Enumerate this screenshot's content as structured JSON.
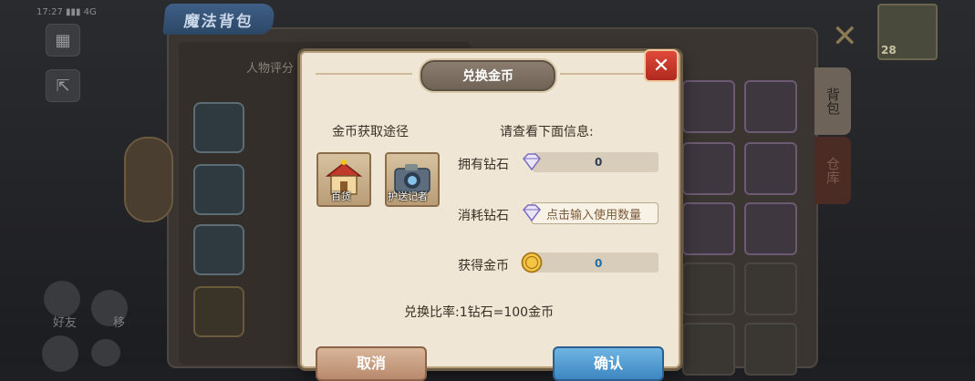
{
  "status_bar": {
    "text": "17:27 ▮▮▮ 4G"
  },
  "background": {
    "bag_title": "魔法背包",
    "rating_label": "人物评分",
    "tabs": {
      "bag": "背包",
      "storage": "仓库"
    },
    "level": "28",
    "bottom_labels": {
      "friends": "好友",
      "second": "移"
    }
  },
  "dialog": {
    "title": "兑换金币",
    "left_section_title": "金币获取途径",
    "sources": [
      {
        "label": "百货",
        "icon": "shop-icon"
      },
      {
        "label": "护送记者",
        "icon": "camera-icon"
      }
    ],
    "right_section_title": "请查看下面信息:",
    "rows": {
      "owned": {
        "label": "拥有钻石",
        "value": "0"
      },
      "consume": {
        "label": "消耗钻石",
        "placeholder": "点击输入使用数量"
      },
      "gain": {
        "label": "获得金币",
        "value": "0"
      }
    },
    "ratio": "兑换比率:1钻石=100金币",
    "cancel_label": "取消",
    "confirm_label": "确认"
  },
  "colors": {
    "dialog_bg": "#efe6d6",
    "close_red": "#d43b2e",
    "confirm_blue": "#4a95cf",
    "cancel_tan": "#c99d7e"
  }
}
